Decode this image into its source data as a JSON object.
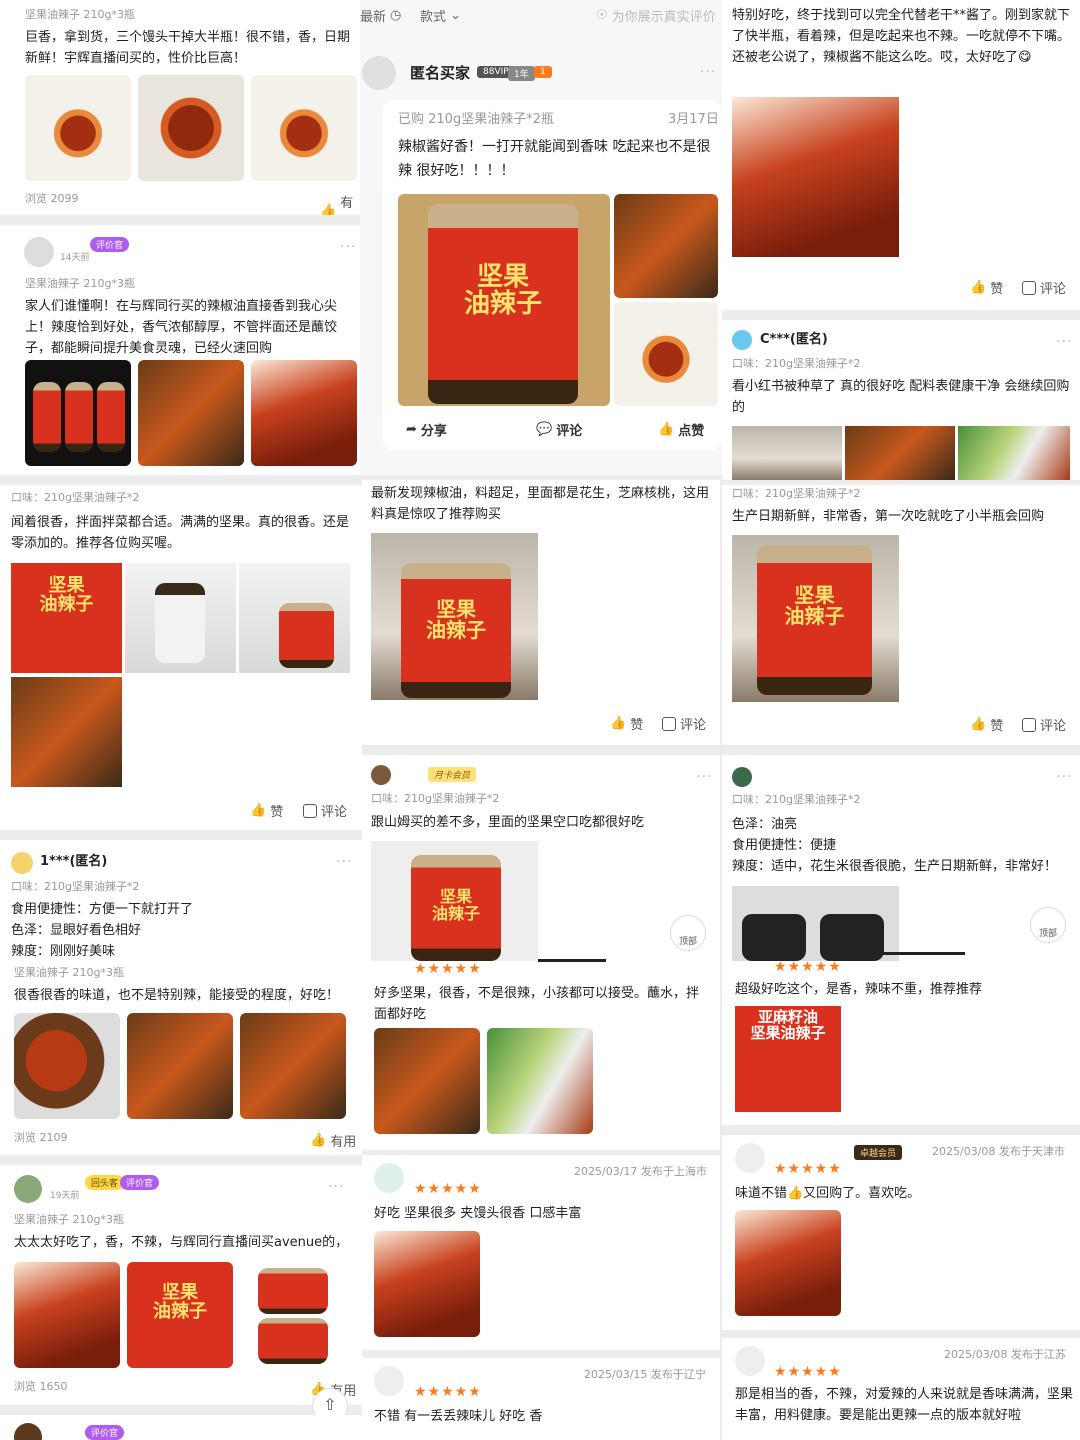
{
  "col1": {
    "card1": {
      "product": "坚果油辣子 210g*3瓶",
      "text": "巨香，拿到货，三个馒头干掉大半瓶！很不错，香，日期新鲜！宇辉直播间买的，性价比巨高！",
      "views": "浏览 2099",
      "useful": "有用"
    },
    "card2": {
      "badge": "评价官",
      "time": "14天前",
      "product": "坚果油辣子 210g*3瓶",
      "text": "家人们谁懂啊！在与辉同行买的辣椒油直接香到我心尖上！辣度恰到好处，香气浓郁醇厚，不管拌面还是蘸饺子，都能瞬间提升美食灵魂，已经火速回购",
      "jar_label": "坚果\n油辣子"
    },
    "card3": {
      "flavor": "口味：210g坚果油辣子*2",
      "text": "闻着很香，拌面拌菜都合适。满满的坚果。真的很香。还是零添加的。推荐各位购买喔。",
      "jar_label": "坚果\n油辣子",
      "like": "赞",
      "comment": "评论"
    },
    "card4": {
      "user": "1***(匿名)",
      "flavor": "口味：210g坚果油辣子*2",
      "line1": "食用便捷性：方便一下就打开了",
      "line2": "色泽：显眼好看色相好",
      "line3": "辣度：刚刚好美味",
      "product": "坚果油辣子 210g*3瓶",
      "text": "很香很香的味道，也不是特别辣，能接受的程度，好吃！",
      "views": "浏览 2109",
      "useful": "有用"
    },
    "card5": {
      "badge1": "回头客",
      "badge2": "评价官",
      "time": "19天前",
      "product": "坚果油辣子 210g*3瓶",
      "text": "太太太好吃了，香，不辣，与辉同行直播间买avenue的，",
      "jar_label": "坚果\n油辣子",
      "views": "浏览 1650",
      "useful": "有用"
    },
    "card6": {
      "badge": "评价官"
    }
  },
  "col2": {
    "topbar": {
      "latest": "最新",
      "style": "款式",
      "notice": "为你展示真实评价"
    },
    "review": {
      "user": "匿名买家",
      "vip": "88VIP",
      "year": "1年",
      "level": "1",
      "purchased": "已购 210g坚果油辣子*2瓶",
      "date": "3月17日",
      "text": "辣椒酱好香！一打开就能闻到香味 吃起来也不是很辣 很好吃！！！！",
      "jar_label": "坚果\n油辣子",
      "share": "分享",
      "comment": "评论",
      "like": "点赞"
    },
    "card2": {
      "text": "最新发现辣椒油，料超足，里面都是花生，芝麻核桃，这用料真是惊叹了推荐购买",
      "jar_label": "坚果\n油辣子",
      "like": "赞",
      "comment": "评论"
    },
    "card3": {
      "member": "月卡会员",
      "flavor": "口味：210g坚果油辣子*2",
      "text": "跟山姆买的差不多，里面的坚果空口吃都很好吃",
      "jar_label": "坚果\n油辣子",
      "top": "顶部",
      "rating": "★★★★★",
      "text2": "好多坚果，很香，不是很辣，小孩都可以接受。蘸水，拌面都好吃"
    },
    "card4": {
      "meta": "2025/03/17 发布于上海市",
      "rating": "★★★★★",
      "text": "好吃 坚果很多 夹馒头很香 口感丰富"
    },
    "card5": {
      "meta": "2025/03/15 发布于辽宁",
      "rating": "★★★★★",
      "text": "不错 有一丢丢辣味儿 好吃 香"
    }
  },
  "col3": {
    "card1": {
      "text": "特别好吃，终于找到可以完全代替老干**酱了。刚到家就下了快半瓶，看着辣，但是吃起来也不辣。一吃就停不下嘴。还被老公说了，辣椒酱不能这么吃。哎，太好吃了😋",
      "like": "赞",
      "comment": "评论"
    },
    "card2": {
      "user": "C***(匿名)",
      "flavor": "口味：210g坚果油辣子*2",
      "text": "看小红书被种草了 真的很好吃 配料表健康干净 会继续回购的"
    },
    "card3": {
      "flavor": "口味：210g坚果油辣子*2",
      "text": "生产日期新鲜，非常香，第一次吃就吃了小半瓶会回购",
      "jar_label": "坚果\n油辣子",
      "like": "赞",
      "comment": "评论"
    },
    "card4": {
      "flavor": "口味：210g坚果油辣子*2",
      "line1": "色泽：油亮",
      "line2": "食用便捷性：便捷",
      "line3": "辣度：适中，花生米很香很脆，生产日期新鲜，非常好！",
      "top": "顶部",
      "rating": "★★★★★",
      "text2": "超级好吃这个，是香，辣味不重，推荐推荐",
      "jar_label": "亚麻籽油\n坚果油辣子"
    },
    "card5": {
      "member": "卓越会员",
      "meta": "2025/03/08 发布于天津市",
      "rating": "★★★★★",
      "text": "味道不错👍又回购了。喜欢吃。"
    },
    "card6": {
      "meta": "2025/03/08 发布于江苏",
      "rating": "★★★★★",
      "text": "那是相当的香，不辣，对爱辣的人来说就是香味满满，坚果丰富，用料健康。要是能出更辣一点的版本就好啦"
    }
  },
  "colors": {
    "accent_orange": "#ff7a1a",
    "badge_purple": "#b05cf0",
    "jar_red": "#d8321e"
  }
}
